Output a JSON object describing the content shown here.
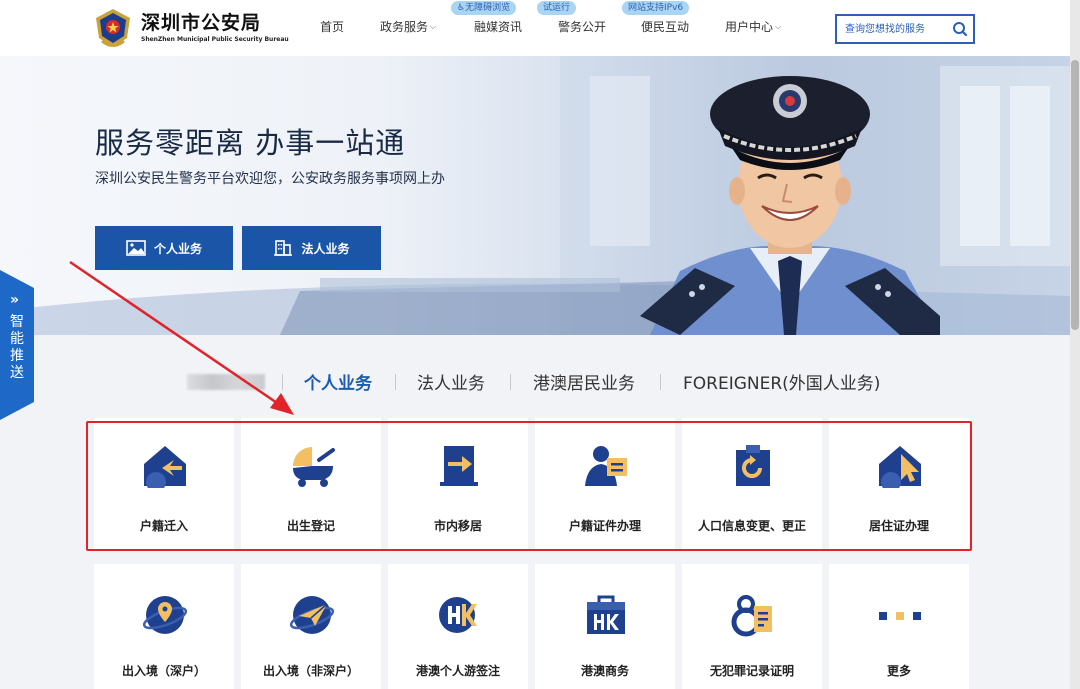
{
  "header": {
    "logo_title": "深圳市公安局",
    "logo_subtitle": "ShenZhen Municipal Public Security Bureau",
    "nav": [
      {
        "label": "首页",
        "caret": false
      },
      {
        "label": "政务服务",
        "caret": true
      },
      {
        "label": "融媒资讯",
        "caret": false
      },
      {
        "label": "警务公开",
        "caret": false
      },
      {
        "label": "便民互动",
        "caret": false
      },
      {
        "label": "用户中心",
        "caret": true
      }
    ],
    "badges": [
      "无障碍浏览",
      "试运行",
      "网站支持IPv6"
    ],
    "search_placeholder": "查询您想找的服务"
  },
  "banner": {
    "title": "服务零距离 办事一站通",
    "subtitle": "深圳公安民生警务平台欢迎您，公安政务服务事项网上办",
    "buttons": [
      "个人业务",
      "法人业务"
    ]
  },
  "side_tab": {
    "arrow": "»",
    "label": "智能推送"
  },
  "tabs": [
    {
      "label": "个人业务",
      "active": true
    },
    {
      "label": "法人业务",
      "active": false
    },
    {
      "label": "港澳居民业务",
      "active": false
    },
    {
      "label": "FOREIGNER(外国人业务)",
      "active": false
    }
  ],
  "services_row1": [
    {
      "label": "户籍迁入",
      "icon": "house-arrow-icon"
    },
    {
      "label": "出生登记",
      "icon": "baby-carriage-icon"
    },
    {
      "label": "市内移居",
      "icon": "move-door-icon"
    },
    {
      "label": "户籍证件办理",
      "icon": "person-card-icon"
    },
    {
      "label": "人口信息变更、更正",
      "icon": "refresh-document-icon"
    },
    {
      "label": "居住证办理",
      "icon": "house-flag-icon"
    }
  ],
  "services_row2": [
    {
      "label": "出入境（深户）",
      "icon": "globe-pin-icon"
    },
    {
      "label": "出入境（非深户）",
      "icon": "globe-plane-icon"
    },
    {
      "label": "港澳个人游签注",
      "icon": "hk-globe-icon"
    },
    {
      "label": "港澳商务",
      "icon": "hk-briefcase-icon"
    },
    {
      "label": "无犯罪记录证明",
      "icon": "handcuffs-certificate-icon"
    },
    {
      "label": "更多",
      "icon": "more-dots-icon"
    }
  ],
  "colors": {
    "brand_blue": "#1b55a8",
    "icon_navy": "#1f3f8f",
    "icon_gold": "#f2c062",
    "annotation_red": "#e0242b"
  }
}
